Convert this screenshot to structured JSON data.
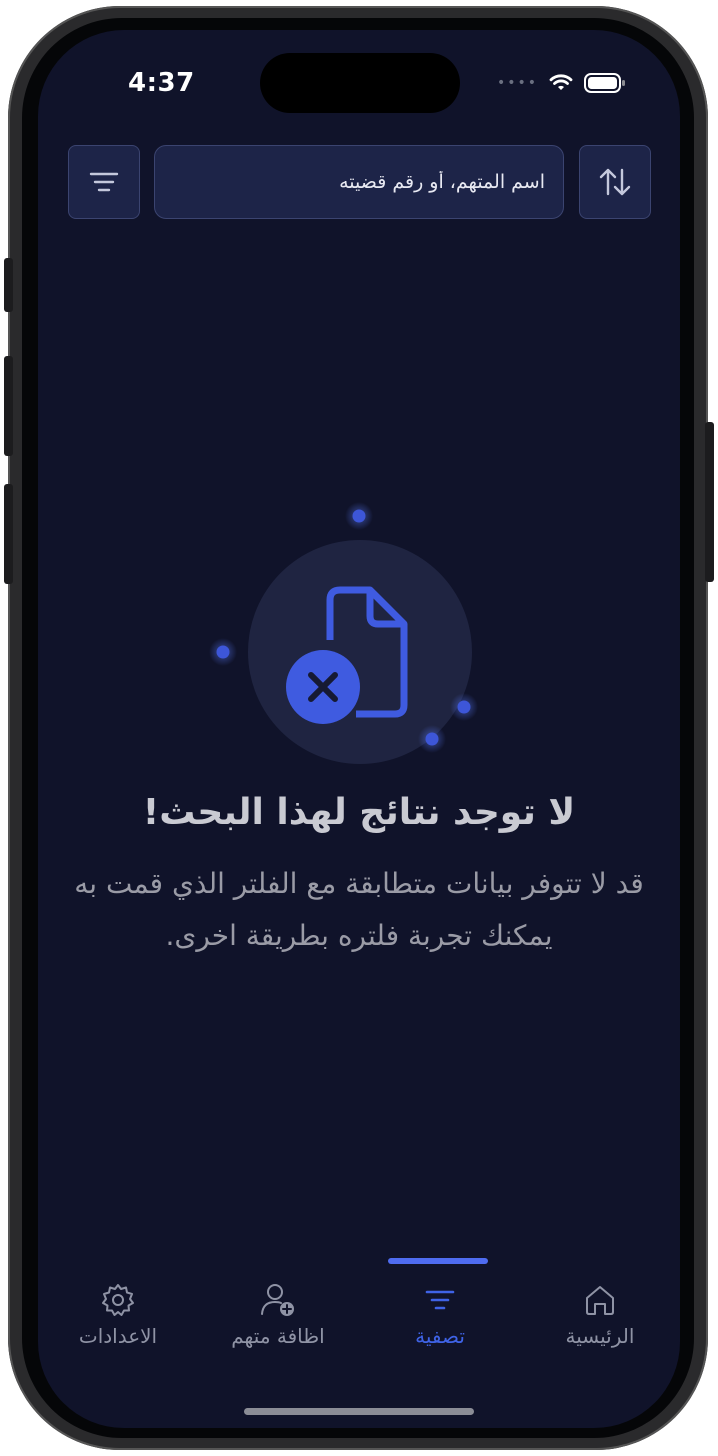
{
  "status_bar": {
    "time": "4:37",
    "signal_icon": "signal-dots-icon",
    "wifi_icon": "wifi-icon",
    "battery_icon": "battery-icon"
  },
  "toolbar": {
    "filter_icon": "filter-lines-icon",
    "search_placeholder": "اسم المتهم، أو رقم قضيته",
    "sort_icon": "sort-arrows-icon"
  },
  "empty_state": {
    "icon": "document-x-icon",
    "title": "لا توجد نتائج لهذا البحث!",
    "message": "قد لا تتوفر بيانات متطابقة مع الفلتر الذي قمت به يمكنك تجربة فلتره بطريقة اخرى."
  },
  "tabs": [
    {
      "label": "الاعدادات",
      "icon": "gear-icon",
      "active": false
    },
    {
      "label": "اظافة متهم",
      "icon": "add-person-icon",
      "active": false
    },
    {
      "label": "تصفية",
      "icon": "filter-icon",
      "active": true
    },
    {
      "label": "الرئيسية",
      "icon": "home-icon",
      "active": false
    }
  ],
  "colors": {
    "background": "#10132a",
    "accent": "#3f63e6",
    "surface": "#1d2448",
    "muted_text": "#9a9ba6"
  }
}
